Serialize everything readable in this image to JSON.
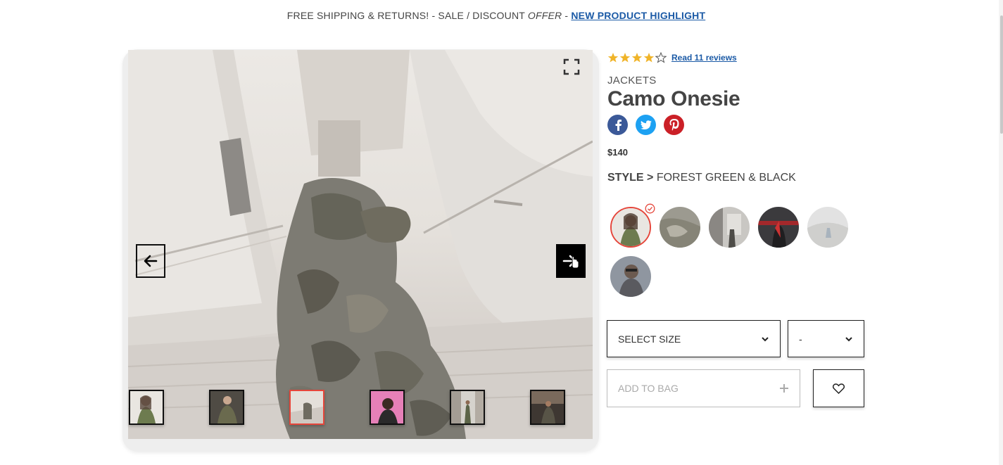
{
  "announcement": {
    "part1": "FREE SHIPPING & RETURNS! - SALE / DISCOUNT ",
    "offer": "OFFER",
    "part2": " - ",
    "link": " NEW PRODUCT HIGHLIGHT"
  },
  "product": {
    "rating": {
      "value": 4,
      "max": 5,
      "reviews_label": "Read 11 reviews"
    },
    "category": "JACKETS",
    "title": "Camo Onesie",
    "price": "$140",
    "style_label": "STYLE >",
    "style_value": "FOREST GREEN & BLACK",
    "selected_swatch_index": 0,
    "swatch_count": 6
  },
  "gallery": {
    "thumbnail_count": 6,
    "active_thumbnail_index": 2,
    "icons": {
      "fullscreen": "fullscreen-icon",
      "prev": "arrow-left-icon",
      "next": "arrow-right-icon",
      "cursor": "hand-pointer-icon"
    }
  },
  "social": [
    "facebook-icon",
    "twitter-icon",
    "pinterest-icon"
  ],
  "controls": {
    "size_label": "SELECT SIZE",
    "qty_label": "-",
    "add_to_bag_label": "ADD TO BAG",
    "add_icon": "plus-icon",
    "wishlist_icon": "heart-icon"
  },
  "colors": {
    "accent_red": "#e5463b",
    "link_blue": "#1b5aa6",
    "star_gold": "#f0b429",
    "facebook": "#3b5998",
    "twitter": "#1da1f2",
    "pinterest": "#cb2027"
  }
}
